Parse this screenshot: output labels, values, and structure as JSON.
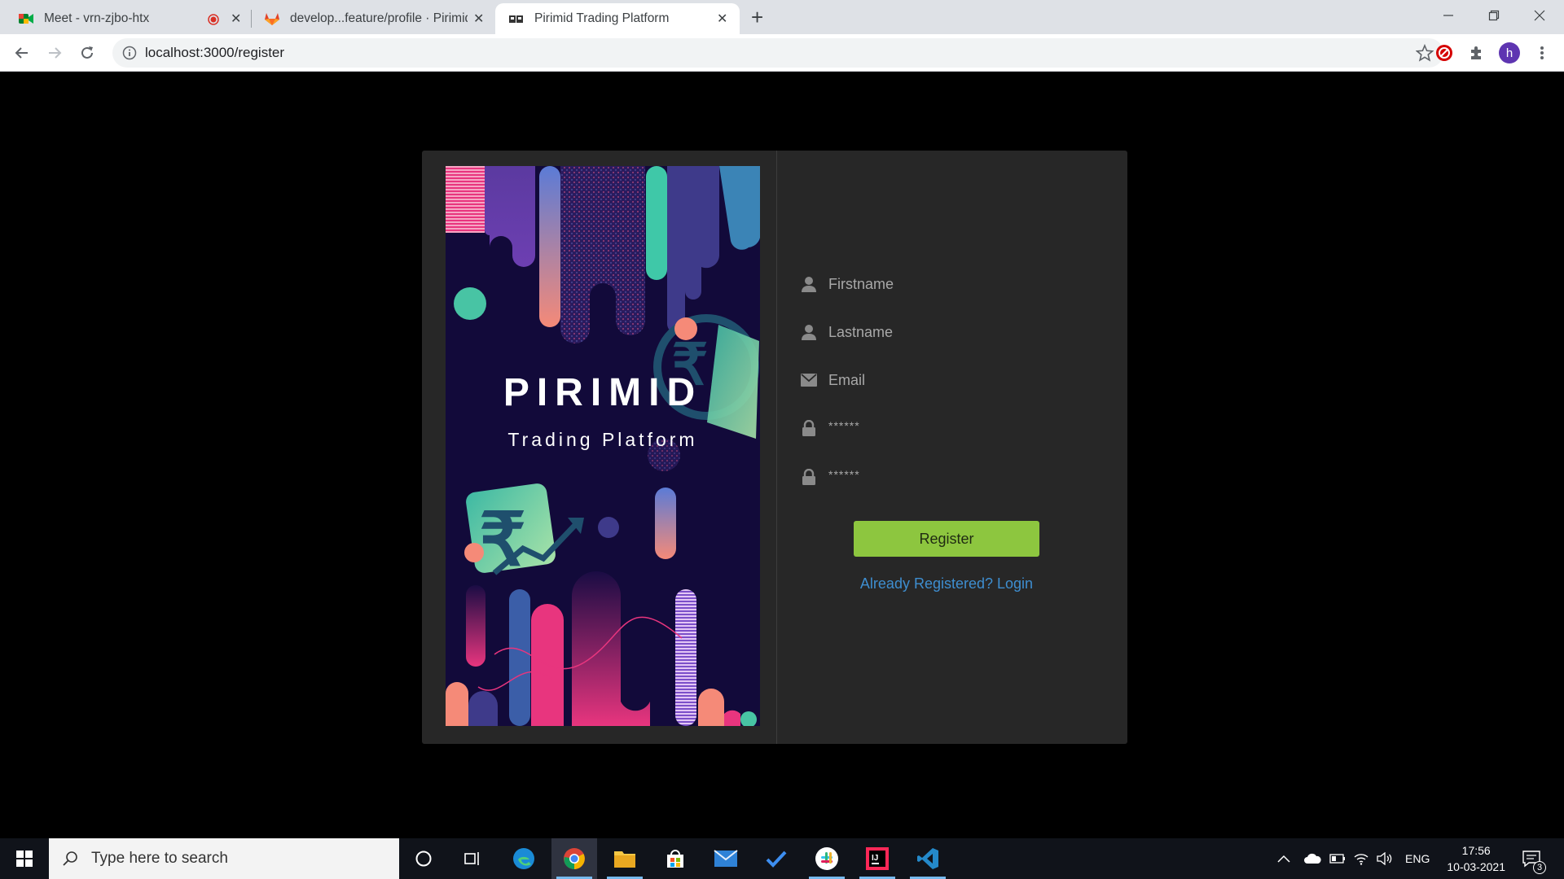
{
  "browser": {
    "tabs": [
      {
        "title": "Meet - vrn-zjbo-htx",
        "favicon": "google-meet-icon",
        "recording": true
      },
      {
        "title": "develop...feature/profile · Pirimid",
        "favicon": "gitlab-icon"
      },
      {
        "title": "Pirimid Trading Platform",
        "favicon": "pirimid-icon",
        "active": true
      }
    ],
    "url": "localhost:3000/register",
    "profile_initial": "h"
  },
  "brand": {
    "name": "PIRIMID",
    "tagline": "Trading Platform"
  },
  "form": {
    "firstname_placeholder": "Firstname",
    "lastname_placeholder": "Lastname",
    "email_placeholder": "Email",
    "password_mask": "******",
    "confirm_password_mask": "******",
    "register_label": "Register",
    "login_link": "Already Registered? Login"
  },
  "taskbar": {
    "search_placeholder": "Type here to search",
    "apps": [
      "cortana-icon",
      "task-view-icon",
      "edge-icon",
      "chrome-icon",
      "file-explorer-icon",
      "store-icon",
      "mail-icon",
      "todo-icon",
      "slack-icon",
      "intellij-icon",
      "vscode-icon"
    ],
    "language": "ENG",
    "time": "17:56",
    "date": "10-03-2021",
    "notification_count": "3"
  },
  "colors": {
    "accent_green": "#8dc63f",
    "link_blue": "#3e8ed0",
    "card_bg": "#272727",
    "art_bg": "#120a3a"
  }
}
